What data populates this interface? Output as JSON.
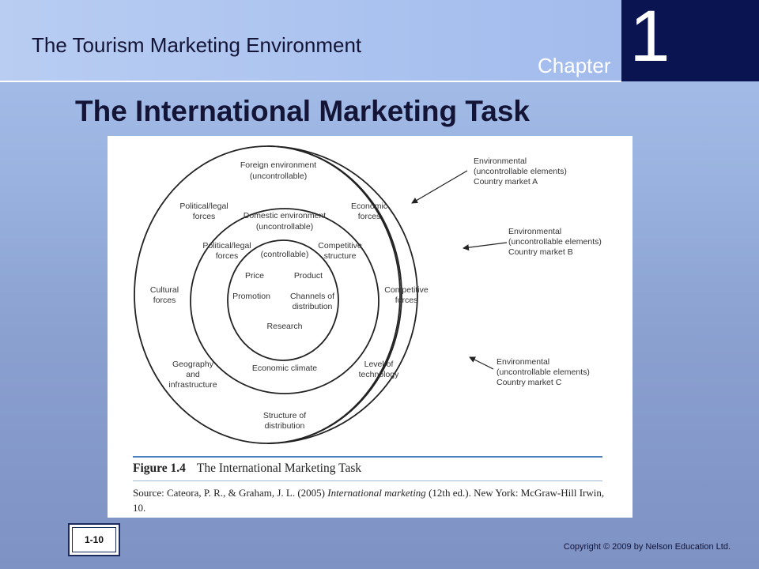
{
  "header": {
    "course_title": "The Tourism Marketing Environment",
    "chapter_word": "Chapter",
    "chapter_number": "1"
  },
  "slide": {
    "title": "The International Marketing Task"
  },
  "figure": {
    "foreign": {
      "title1": "Foreign environment",
      "title2": "(uncontrollable)",
      "political1": "Political/legal",
      "political2": "forces",
      "economic1": "Economic",
      "economic2": "forces",
      "cultural1": "Cultural",
      "cultural2": "forces",
      "competitive1": "Competitive",
      "competitive2": "forces",
      "geography1": "Geography",
      "geography2": "and",
      "geography3": "infrastructure",
      "technology1": "Level of",
      "technology2": "technology",
      "structure1": "Structure of",
      "structure2": "distribution"
    },
    "domestic": {
      "title1": "Domestic environment",
      "title2": "(uncontrollable)",
      "political1": "Political/legal",
      "political2": "forces",
      "competitive1": "Competitive",
      "competitive2": "structure",
      "economic_climate": "Economic climate"
    },
    "controllable": {
      "title": "(controllable)",
      "price": "Price",
      "product": "Product",
      "promotion": "Promotion",
      "channels1": "Channels of",
      "channels2": "distribution",
      "research": "Research"
    },
    "markets": [
      {
        "line1": "Environmental",
        "line2": "(uncontrollable elements)",
        "line3": "Country market A"
      },
      {
        "line1": "Environmental",
        "line2": "(uncontrollable elements)",
        "line3": "Country market B"
      },
      {
        "line1": "Environmental",
        "line2": "(uncontrollable elements)",
        "line3": "Country market  C"
      }
    ],
    "caption_number": "Figure 1.4",
    "caption_title": "The International Marketing Task",
    "source_prefix": "Source: Cateora, P. R., & Graham, J. L. (2005) ",
    "source_title": "International marketing",
    "source_suffix": " (12th ed.). New York: McGraw-Hill Irwin, 10."
  },
  "footer": {
    "slide_number": "1-10",
    "copyright": "Copyright © 2009 by Nelson Education Ltd."
  }
}
